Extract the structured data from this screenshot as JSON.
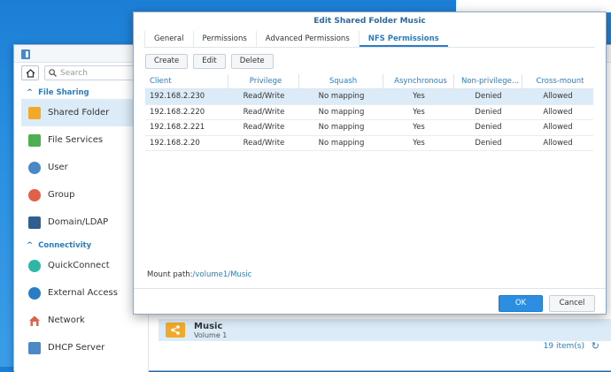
{
  "sidebar": {
    "search_placeholder": "Search",
    "sections": [
      {
        "label": "File Sharing"
      },
      {
        "label": "Connectivity"
      }
    ],
    "items": [
      {
        "label": "Shared Folder",
        "icon": "shared-folder-icon",
        "color": "#f3a928"
      },
      {
        "label": "File Services",
        "icon": "file-services-icon",
        "color": "#4caf50"
      },
      {
        "label": "User",
        "icon": "user-icon",
        "color": "#4a88c8"
      },
      {
        "label": "Group",
        "icon": "group-icon",
        "color": "#e0604a"
      },
      {
        "label": "Domain/LDAP",
        "icon": "domain-ldap-icon",
        "color": "#2f5f8f"
      },
      {
        "label": "QuickConnect",
        "icon": "quickconnect-icon",
        "color": "#2fb7a5"
      },
      {
        "label": "External Access",
        "icon": "globe-icon",
        "color": "#2a7dc4"
      },
      {
        "label": "Network",
        "icon": "network-house-icon",
        "color": "#e0604a"
      },
      {
        "label": "DHCP Server",
        "icon": "dhcp-icon",
        "color": "#4a88c8"
      }
    ]
  },
  "folder_row": {
    "title": "Music",
    "subtitle": "Volume 1"
  },
  "items_count": "19 item(s)",
  "dialog": {
    "title": "Edit Shared Folder Music",
    "tabs": [
      "General",
      "Permissions",
      "Advanced Permissions",
      "NFS Permissions"
    ],
    "active_tab": "NFS Permissions",
    "toolbar": {
      "create": "Create",
      "edit": "Edit",
      "delete": "Delete"
    },
    "columns": [
      "Client",
      "Privilege",
      "Squash",
      "Asynchronous",
      "Non-privilege...",
      "Cross-mount"
    ],
    "rows": [
      [
        "192.168.2.230",
        "Read/Write",
        "No mapping",
        "Yes",
        "Denied",
        "Allowed"
      ],
      [
        "192.168.2.220",
        "Read/Write",
        "No mapping",
        "Yes",
        "Denied",
        "Allowed"
      ],
      [
        "192.168.2.221",
        "Read/Write",
        "No mapping",
        "Yes",
        "Denied",
        "Allowed"
      ],
      [
        "192.168.2.20",
        "Read/Write",
        "No mapping",
        "Yes",
        "Denied",
        "Allowed"
      ]
    ],
    "mount_label": "Mount path:",
    "mount_path": "/volume1/Music",
    "ok": "OK",
    "cancel": "Cancel"
  },
  "colors": {
    "accent": "#2a7dc4",
    "selection": "#dcebf8",
    "ok_button": "#2b8ee0"
  }
}
